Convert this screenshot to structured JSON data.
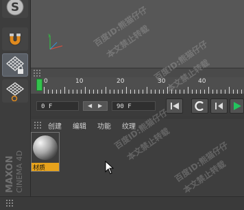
{
  "toolbar": {
    "tools": [
      {
        "name": "snap-tool",
        "icon": "s-icon"
      },
      {
        "name": "magnet-tool",
        "icon": "magnet-icon"
      },
      {
        "name": "locked-workplane-tool",
        "icon": "grid-lock-icon"
      },
      {
        "name": "workplane-tool",
        "icon": "grid-icon"
      }
    ]
  },
  "timeline": {
    "ruler_labels": [
      "0",
      "10",
      "20",
      "30",
      "40"
    ]
  },
  "playback": {
    "current_frame": "0 F",
    "end_frame": "90 F"
  },
  "material_manager": {
    "menu": [
      "创建",
      "编辑",
      "功能",
      "纹理"
    ],
    "materials": [
      {
        "name": "材质"
      }
    ]
  },
  "brand": {
    "line1": "MAXON",
    "line2": "CINEMA 4D"
  },
  "watermark": {
    "line1": "百度ID:熊猫仔仔",
    "line2": "本文禁止转载"
  },
  "colors": {
    "accent": "#f39c12",
    "play": "#22c55e",
    "mat_label_bg": "#e6a21c"
  }
}
